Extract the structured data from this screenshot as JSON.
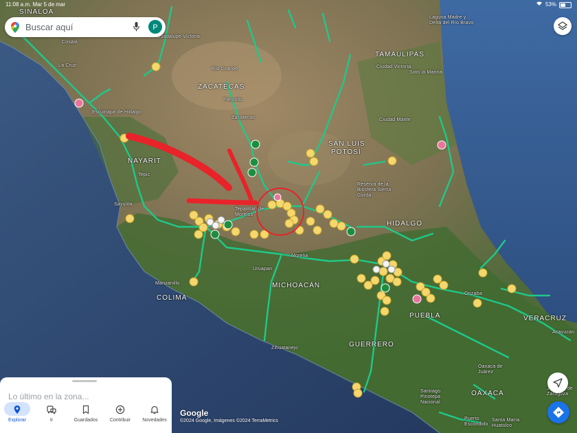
{
  "status": {
    "time": "11:08 a.m.",
    "date": "Mar 5 de mar",
    "battery": "53%",
    "battery_level": 0.53
  },
  "search": {
    "placeholder": "Buscar aquí",
    "avatar_initial": "P"
  },
  "icons": {
    "maps_pin": "google-maps-pin-icon",
    "mic": "mic-icon",
    "layers": "layers-icon",
    "locate": "navigation-arrow-icon",
    "directions": "directions-icon"
  },
  "colors": {
    "road": "#1ec98a",
    "restaurant": "#f5d76e",
    "park": "#1e8e3e",
    "shopping": "#e8769c",
    "annotation": "#e8232a",
    "accent": "#1a73e8"
  },
  "map_labels": {
    "states": {
      "sinaloa": "SINALOA",
      "zacatecas": "ZACATECAS",
      "tamaulipas": "TAMAULIPAS",
      "nayarit": "NAYARIT",
      "san_luis_potosi_1": "SAN LUIS",
      "san_luis_potosi_2": "POTOSÍ",
      "hidalgo": "HIDALGO",
      "michoacan": "MICHOACÁN",
      "colima": "COLIMA",
      "puebla": "PUEBLA",
      "veracruz": "VERACRUZ",
      "guerrero": "GUERRERO",
      "oaxaca": "OAXACA"
    },
    "cities": {
      "guadalupe_victoria": "Guadalupe Victoria",
      "cosala": "Cosalá",
      "la_cruz": "La Cruz",
      "rio_grande": "Río Grande",
      "fresnillo": "Fresnillo",
      "escuinapa": "Escuinapa de Hidalgo",
      "zacatecas_city": "Zacatecas",
      "ciudad_victoria": "Ciudad Victoria",
      "soto_la_marina": "Soto la Marina",
      "laguna_madre": "Laguna Madre y Delta del Río Bravo",
      "ciudad_mante": "Ciudad Mante",
      "tepic": "Tepic",
      "sayulita": "Sayulita",
      "sierra_gorda": "Reserva de la Biosfera Sierra Gorda",
      "tepatitlan": "Tepatitlán de Morelos",
      "morelia": "Morelia",
      "uruapan": "Uruapan",
      "manzanillo": "Manzanillo",
      "zihuatanejo": "Zihuatanejo",
      "orizaba": "Orizaba",
      "acayucan": "Acayucan",
      "oaxaca_juarez": "Oaxaca de Juárez",
      "santiago_pinotepa": "Santiago Pinotepa Nacional",
      "puerto_escondido": "Puerto Escondido",
      "santa_maria": "Santa María Huatulco",
      "juchitan": "Juchitán de Zaragoza"
    }
  },
  "map": {
    "google_logo": "Google",
    "attribution": "©2024 Google, Imágenes ©2024 TerraMetrics"
  },
  "bottom_sheet": {
    "title": "Lo último en la zona...",
    "nav": [
      {
        "label": "Explorar",
        "icon": "explore-pin-icon",
        "active": true
      },
      {
        "label": "Ir",
        "icon": "commute-icon",
        "active": false
      },
      {
        "label": "Guardados",
        "icon": "bookmark-icon",
        "active": false
      },
      {
        "label": "Contribuir",
        "icon": "add-circle-icon",
        "active": false
      },
      {
        "label": "Novedades",
        "icon": "bell-icon",
        "active": false
      }
    ]
  }
}
